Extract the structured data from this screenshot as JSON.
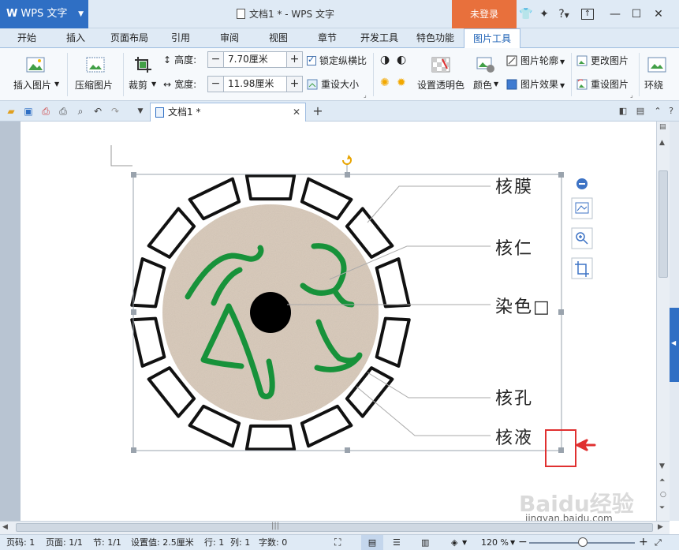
{
  "titlebar": {
    "app_name": "WPS 文字",
    "window_title": "文档1 * - WPS 文字",
    "login_label": "未登录",
    "help_label": "?"
  },
  "tabs": [
    {
      "label": "开始"
    },
    {
      "label": "插入"
    },
    {
      "label": "页面布局"
    },
    {
      "label": "引用"
    },
    {
      "label": "审阅"
    },
    {
      "label": "视图"
    },
    {
      "label": "章节"
    },
    {
      "label": "开发工具"
    },
    {
      "label": "特色功能"
    },
    {
      "label": "图片工具"
    }
  ],
  "ribbon": {
    "insert_picture": "插入图片",
    "compress_picture": "压缩图片",
    "crop": "裁剪",
    "height_label": "高度:",
    "height_value": "7.70厘米",
    "width_label": "宽度:",
    "width_value": "11.98厘米",
    "lock_ratio": "锁定纵横比",
    "reset_size": "重设大小",
    "set_transparent": "设置透明色",
    "color": "颜色",
    "picture_outline": "图片轮廓",
    "picture_effect": "图片效果",
    "change_picture": "更改图片",
    "reset_picture": "重设图片",
    "wrap": "环绕"
  },
  "doc_tab": {
    "label": "文档1 *"
  },
  "diagram": {
    "labels": [
      "核膜",
      "核仁",
      "染色□",
      "核孔",
      "核液"
    ]
  },
  "watermark": {
    "brand": "Baidu经验",
    "url": "jingyan.baidu.com"
  },
  "statusbar": {
    "page_num": "页码: 1",
    "pages": "页面: 1/1",
    "section": "节: 1/1",
    "setting": "设置值: 2.5厘米",
    "row": "行: 1",
    "col": "列: 1",
    "chars": "字数: 0",
    "zoom": "120 %"
  },
  "colors": {
    "accent": "#2f6fc4",
    "login": "#e8703c",
    "nucleus_fill": "#d7c8b8",
    "chromatin": "#17923a",
    "highlight": "#e03030"
  }
}
